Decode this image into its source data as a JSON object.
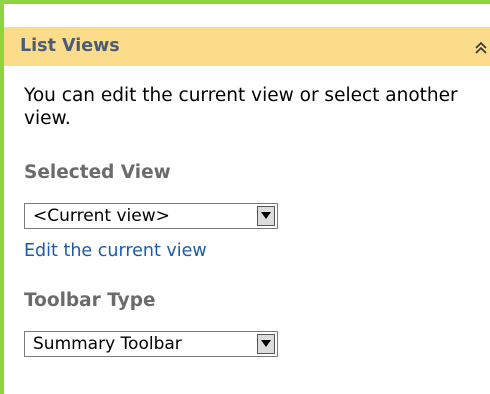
{
  "panel": {
    "title": "List Views",
    "collapse_icon": "double-chevron-up-icon"
  },
  "description": "You can edit the current view or select another view.",
  "selected_view": {
    "label": "Selected View",
    "value": "<Current view>",
    "edit_link": "Edit the current view"
  },
  "toolbar_type": {
    "label": "Toolbar Type",
    "value": "Summary Toolbar"
  },
  "colors": {
    "header_bg": "#fbdc8a",
    "border": "#8fd43c",
    "link": "#1e5aa8"
  }
}
